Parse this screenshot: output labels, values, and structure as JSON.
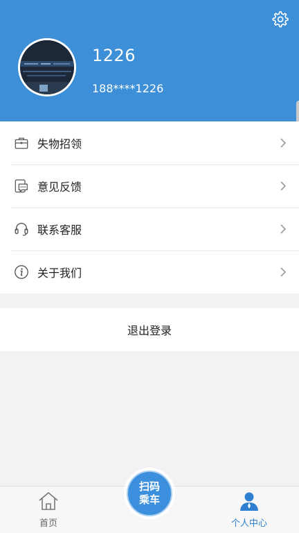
{
  "profile": {
    "name": "1226",
    "phone": "188****1226"
  },
  "menu": [
    {
      "label": "失物招领",
      "icon": "briefcase-icon"
    },
    {
      "label": "意见反馈",
      "icon": "feedback-icon"
    },
    {
      "label": "联系客服",
      "icon": "headset-icon"
    },
    {
      "label": "关于我们",
      "icon": "info-icon"
    }
  ],
  "logout_label": "退出登录",
  "tabs": {
    "home": "首页",
    "profile": "个人中心"
  },
  "scan": {
    "line1": "扫码",
    "line2": "乘车"
  },
  "colors": {
    "header": "#3d8fd8",
    "accent": "#2f80d0"
  }
}
